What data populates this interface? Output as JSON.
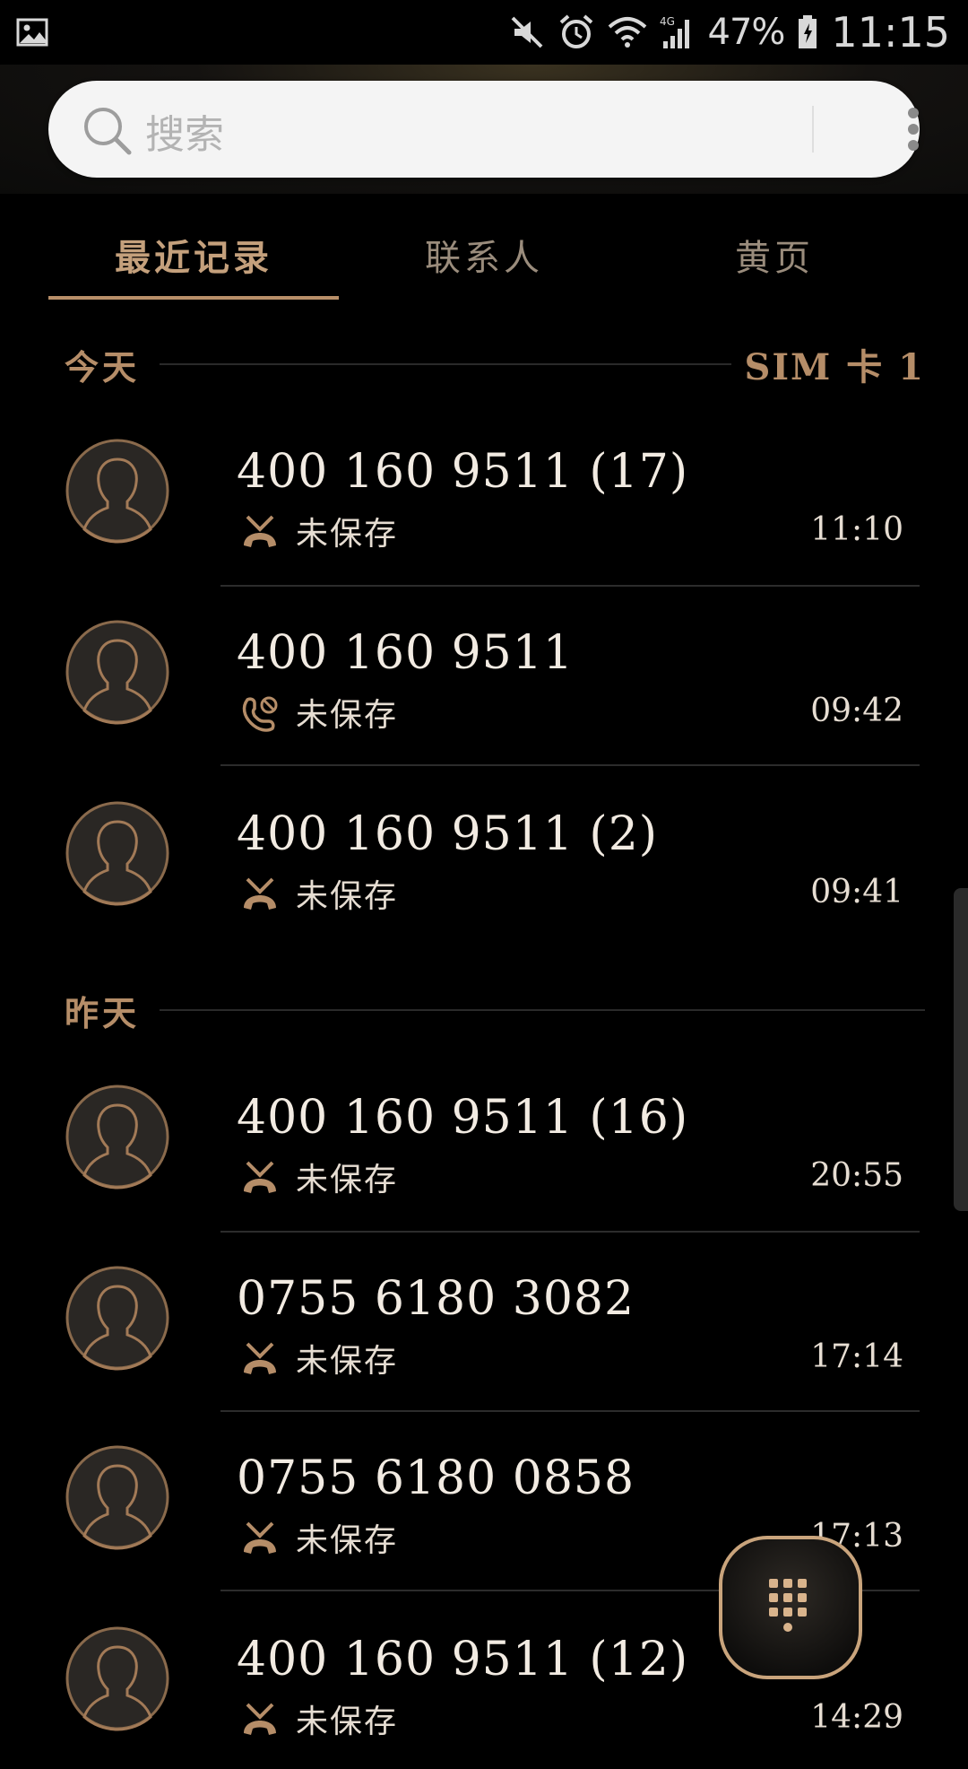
{
  "status_bar": {
    "battery": "47%",
    "time": "11:15",
    "network": "4G",
    "icons": [
      "gallery-icon",
      "mute-icon",
      "alarm-icon",
      "wifi-icon",
      "signal-icon",
      "battery-charging-icon"
    ]
  },
  "search": {
    "placeholder": "搜索"
  },
  "tabs": [
    {
      "label": "最近记录",
      "active": true
    },
    {
      "label": "联系人",
      "active": false
    },
    {
      "label": "黄页",
      "active": false
    }
  ],
  "sections": [
    {
      "title": "今天",
      "sim": "SIM 卡 1",
      "calls": [
        {
          "number": "400 160 9511 (17)",
          "status": "未保存",
          "time": "11:10",
          "type": "rejected"
        },
        {
          "number": "400 160 9511",
          "status": "未保存",
          "time": "09:42",
          "type": "blocked"
        },
        {
          "number": "400 160 9511 (2)",
          "status": "未保存",
          "time": "09:41",
          "type": "rejected"
        }
      ]
    },
    {
      "title": "昨天",
      "calls": [
        {
          "number": "400 160 9511 (16)",
          "status": "未保存",
          "time": "20:55",
          "type": "rejected"
        },
        {
          "number": "0755 6180 3082",
          "status": "未保存",
          "time": "17:14",
          "type": "rejected"
        },
        {
          "number": "0755 6180 0858",
          "status": "未保存",
          "time": "17:13",
          "type": "rejected"
        },
        {
          "number": "400 160 9511 (12)",
          "status": "未保存",
          "time": "14:29",
          "type": "rejected"
        }
      ]
    }
  ],
  "colors": {
    "accent": "#b58d68",
    "background": "#000000",
    "text": "#f2ebe2"
  }
}
